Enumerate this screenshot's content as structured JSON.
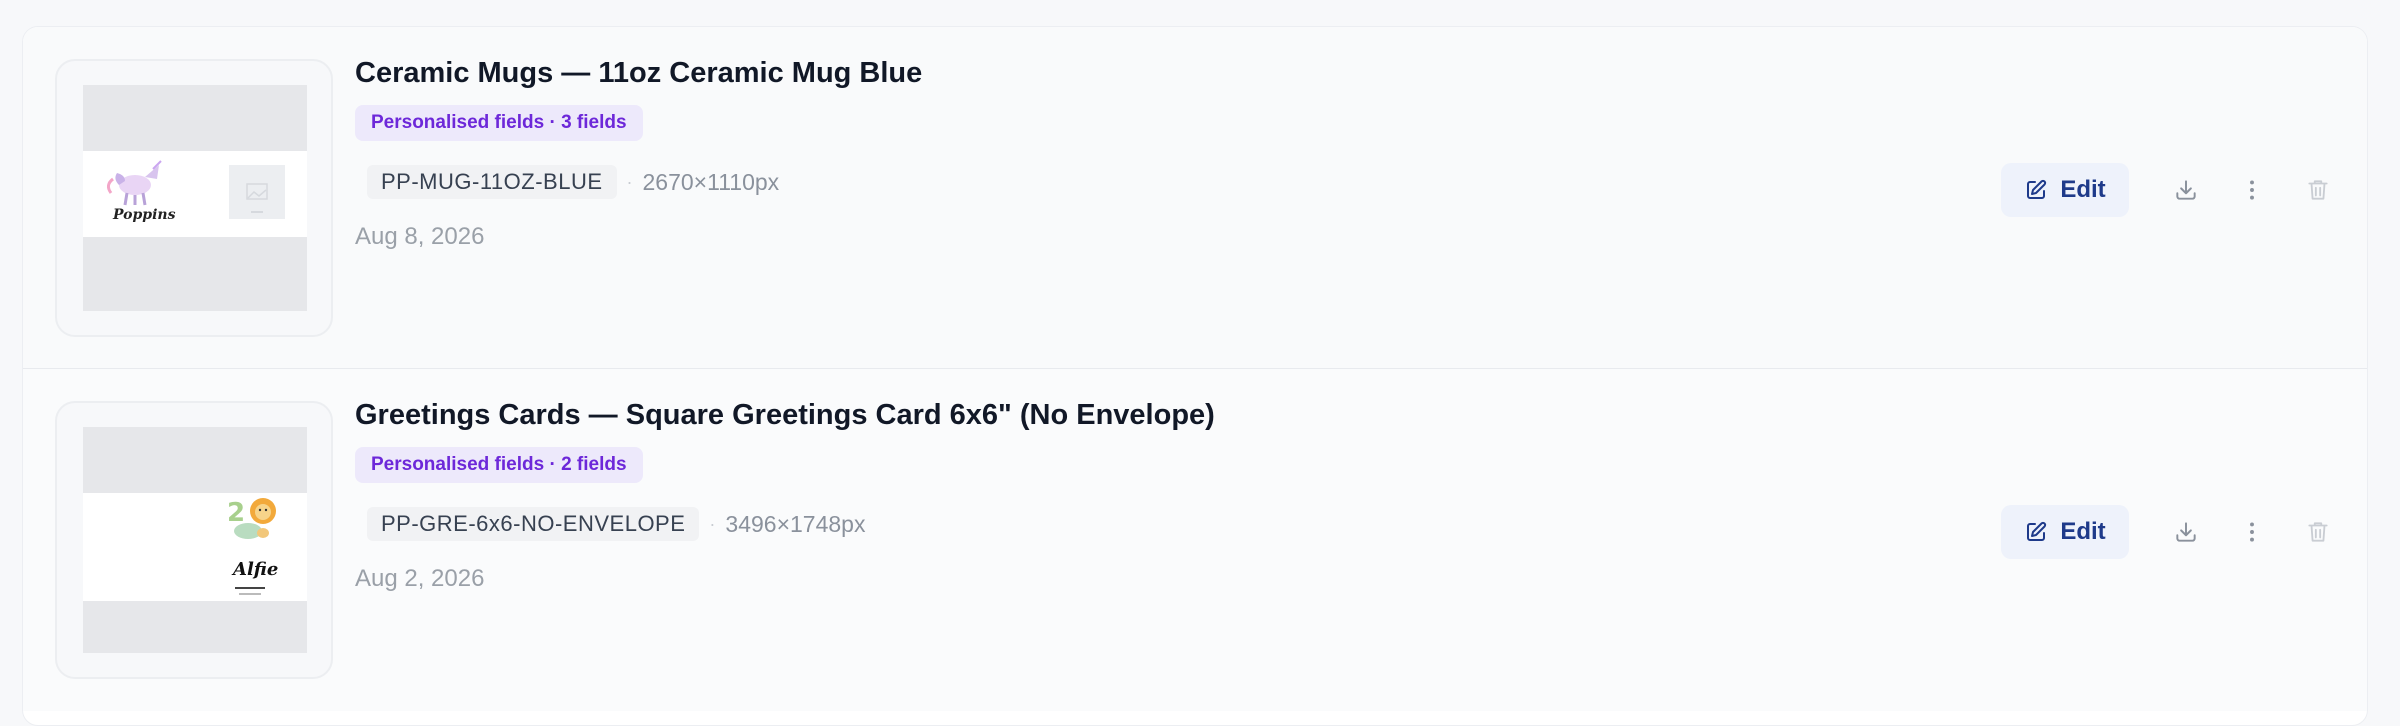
{
  "products": [
    {
      "title": "Ceramic Mugs — 11oz Ceramic Mug Blue",
      "badge": "Personalised fields · 3 fields",
      "sku": "PP-MUG-11OZ-BLUE",
      "separator": "·",
      "dimensions": "2670×1110px",
      "date": "Aug 8, 2026",
      "thumbnail_text": "Poppins",
      "edit_label": "Edit"
    },
    {
      "title": "Greetings Cards — Square Greetings Card 6x6\" (No Envelope)",
      "badge": "Personalised fields · 2 fields",
      "sku": "PP-GRE-6x6-NO-ENVELOPE",
      "separator": "·",
      "dimensions": "3496×1748px",
      "date": "Aug 2, 2026",
      "thumbnail_text": "Alfie",
      "edit_label": "Edit"
    }
  ],
  "icons": {
    "edit": "pencil-square-icon",
    "download": "download-icon",
    "more": "more-vertical-icon",
    "delete": "trash-icon"
  },
  "colors": {
    "badge_bg": "#ede9fb",
    "badge_text": "#6d28d9",
    "edit_bg": "#eef2fb",
    "edit_text": "#1e3a8a"
  }
}
